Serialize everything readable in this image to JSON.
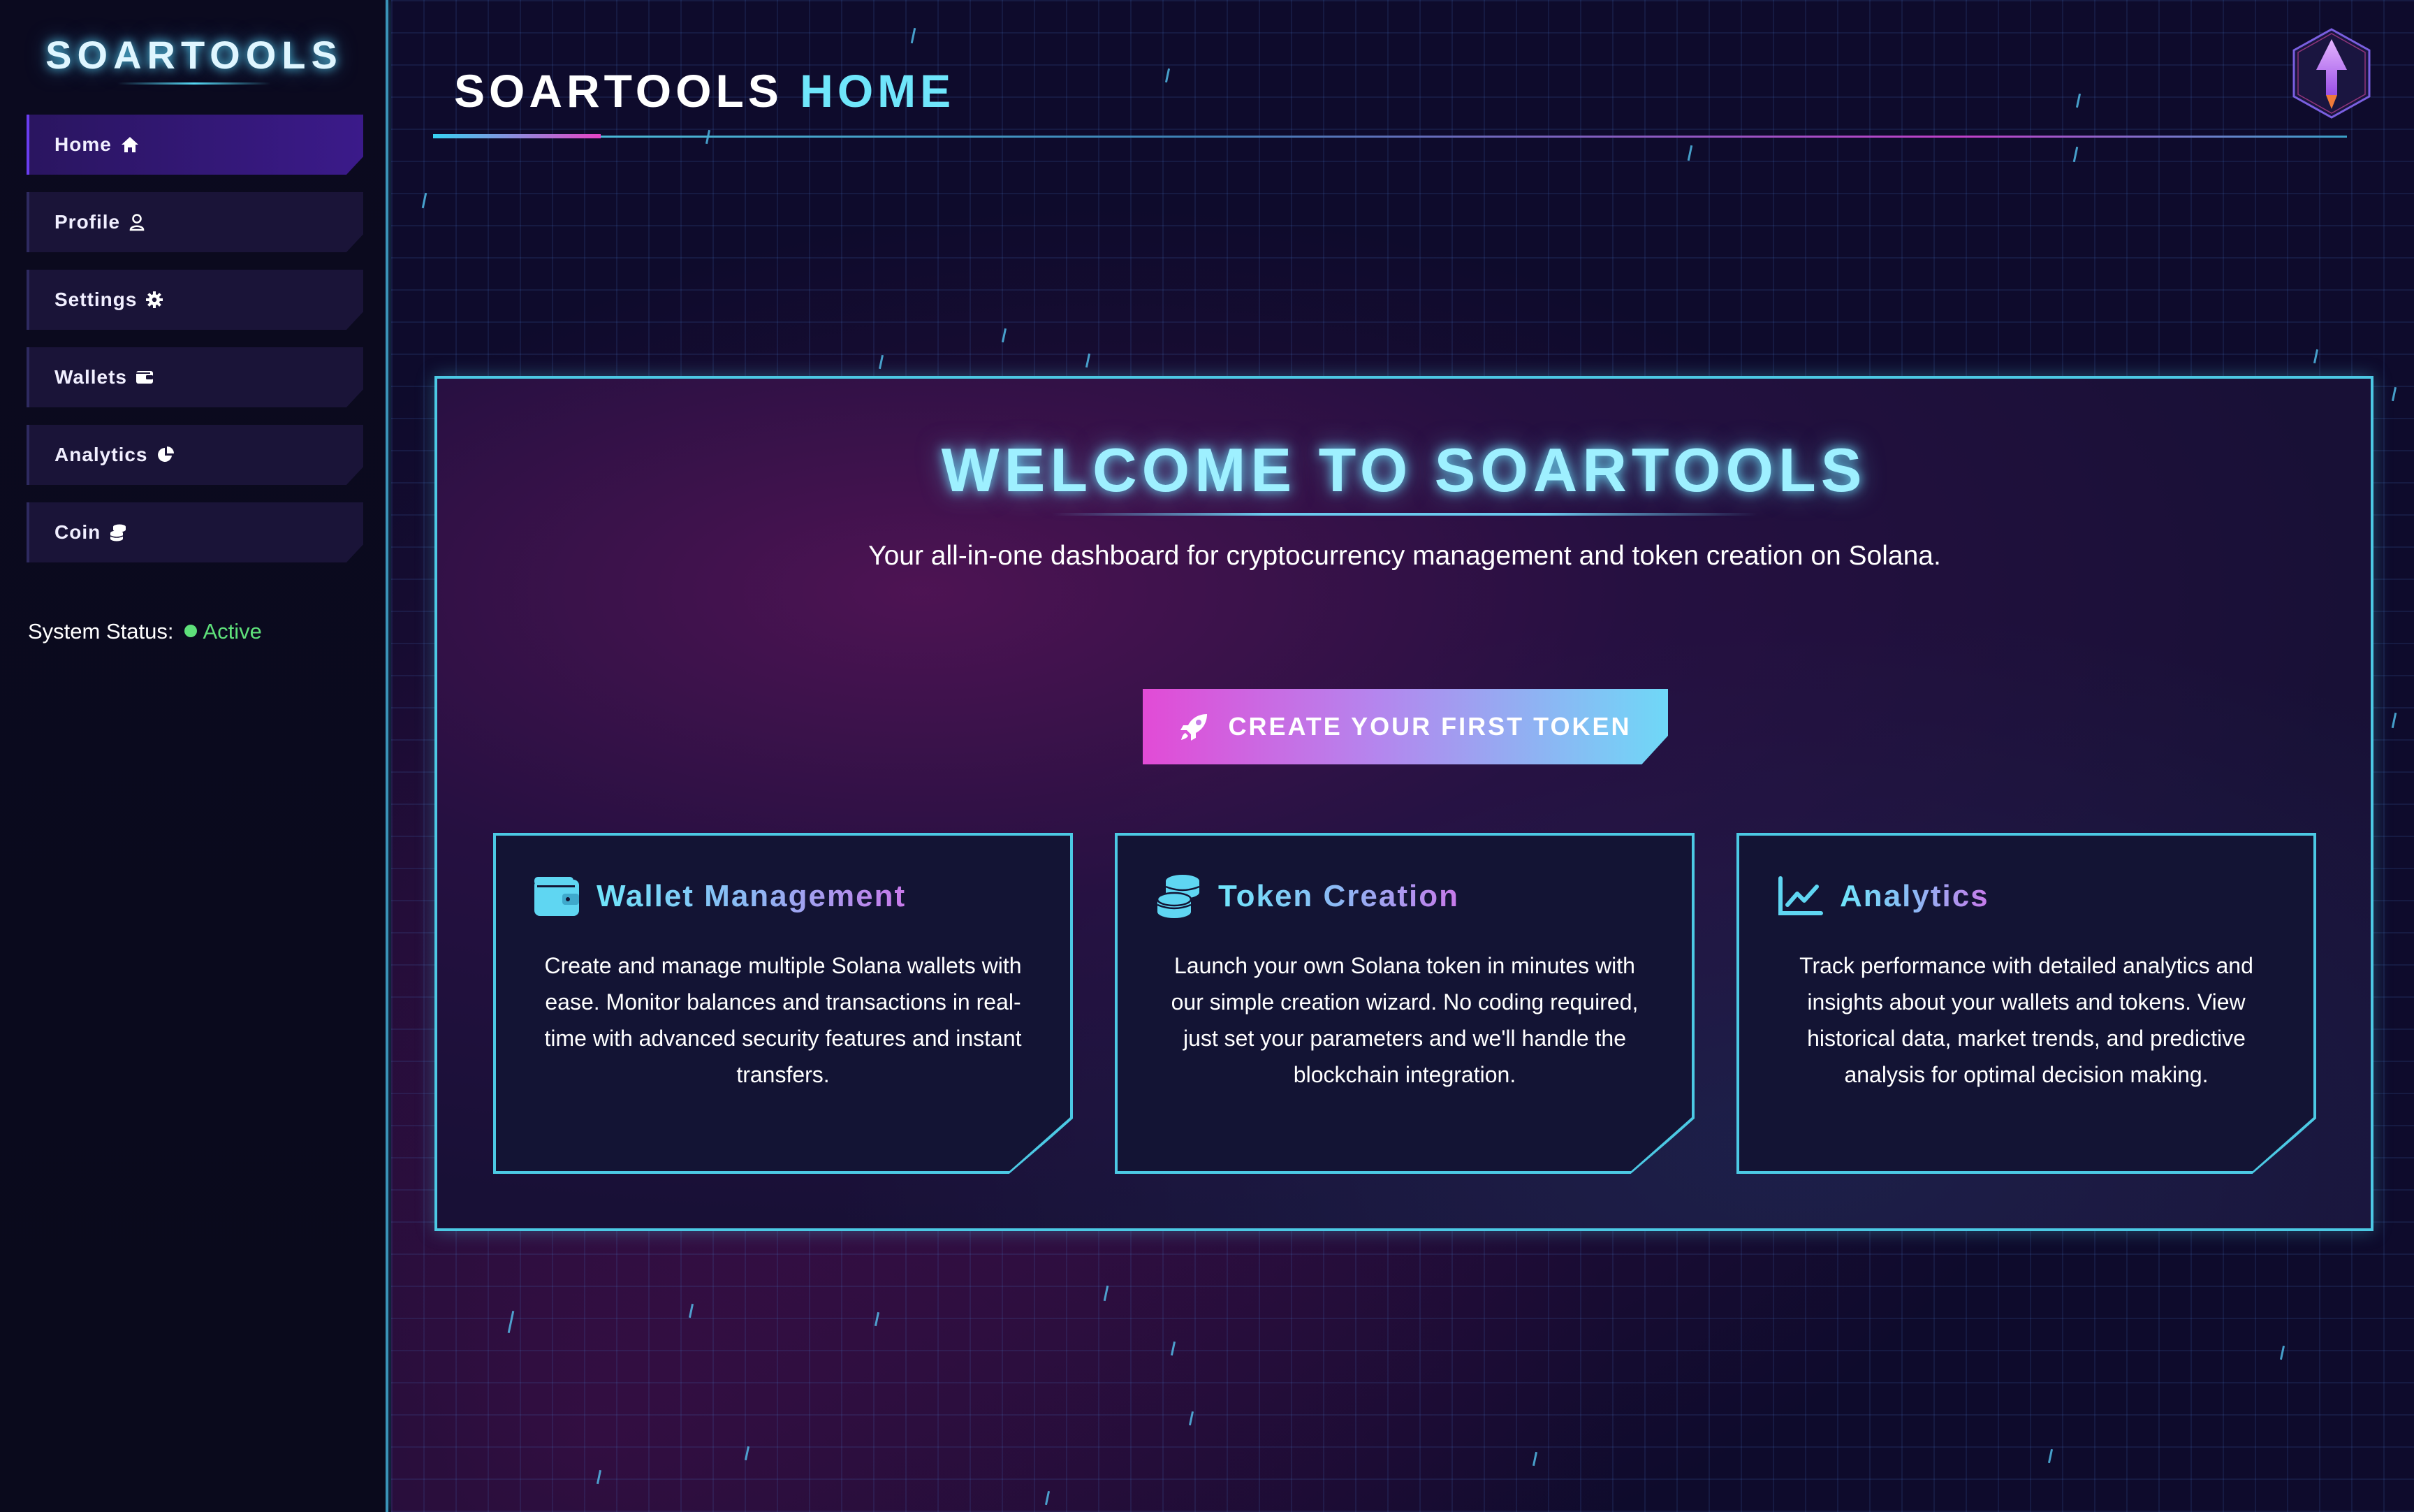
{
  "sidebar": {
    "logo": "SOARTOOLS",
    "items": [
      {
        "label": "Home",
        "icon": "home-icon",
        "active": true
      },
      {
        "label": "Profile",
        "icon": "user-icon",
        "active": false
      },
      {
        "label": "Settings",
        "icon": "gear-icon",
        "active": false
      },
      {
        "label": "Wallets",
        "icon": "wallet-icon",
        "active": false
      },
      {
        "label": "Analytics",
        "icon": "pie-chart-icon",
        "active": false
      },
      {
        "label": "Coin",
        "icon": "coins-icon",
        "active": false
      }
    ],
    "status_label": "System Status:",
    "status_value": "Active"
  },
  "header": {
    "title_part1": "SOARTOOLS",
    "title_part2": "HOME",
    "badge_icon": "rocket-badge-icon"
  },
  "hero": {
    "title": "WELCOME TO SOARTOOLS",
    "subtitle": "Your all-in-one dashboard for cryptocurrency management and token creation on Solana.",
    "cta_label": "CREATE YOUR FIRST TOKEN",
    "cta_icon": "rocket-icon"
  },
  "cards": [
    {
      "title": "Wallet Management",
      "icon": "wallet-icon",
      "text": "Create and manage multiple Solana wallets with ease. Monitor balances and transactions in real-time with advanced security features and instant transfers."
    },
    {
      "title": "Token Creation",
      "icon": "coins-icon",
      "text": "Launch your own Solana token in minutes with our simple creation wizard. No coding required, just set your parameters and we'll handle the blockchain integration."
    },
    {
      "title": "Analytics",
      "icon": "line-chart-icon",
      "text": "Track performance with detailed analytics and insights about your wallets and tokens. View historical data, market trends, and predictive analysis for optimal decision making."
    }
  ],
  "colors": {
    "accent_cyan": "#6fe6fb",
    "accent_magenta": "#e24bd6",
    "status_green": "#5ee07a",
    "active_nav": "#3b1a8a"
  }
}
